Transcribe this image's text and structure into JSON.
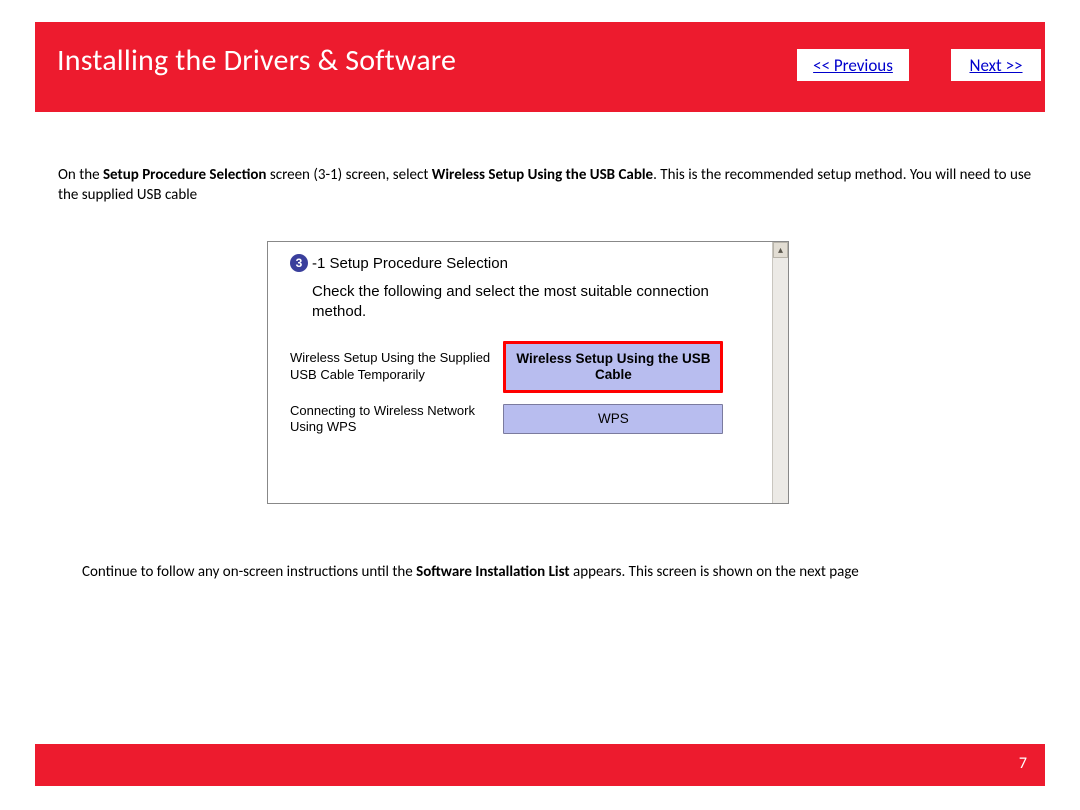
{
  "header": {
    "title": "Installing  the Drivers & Software",
    "prev_label": "<< Previous",
    "next_label": "Next >>"
  },
  "intro": {
    "pre": "On the ",
    "bold1": "Setup Procedure Selection",
    "mid1": " screen (3-1) screen, select ",
    "bold2": "Wireless Setup Using the USB Cable",
    "post": ".  This is the recommended setup method. You will need to use the supplied USB cable"
  },
  "shot": {
    "step_num": "3",
    "step_title": "-1 Setup Procedure Selection",
    "step_desc": "Check the following and select the most suitable connection method.",
    "rows": [
      {
        "label": "Wireless Setup Using the Supplied USB Cable Temporarily",
        "button": "Wireless Setup Using the USB Cable",
        "highlight": true
      },
      {
        "label": "Connecting to Wireless Network Using WPS",
        "button": "WPS",
        "highlight": false
      }
    ]
  },
  "continue_text": {
    "pre": "Continue to follow any on-screen instructions until the ",
    "bold": "Software Installation List",
    "post": " appears.  This screen is shown on the next page"
  },
  "footer": {
    "page_number": "7"
  }
}
